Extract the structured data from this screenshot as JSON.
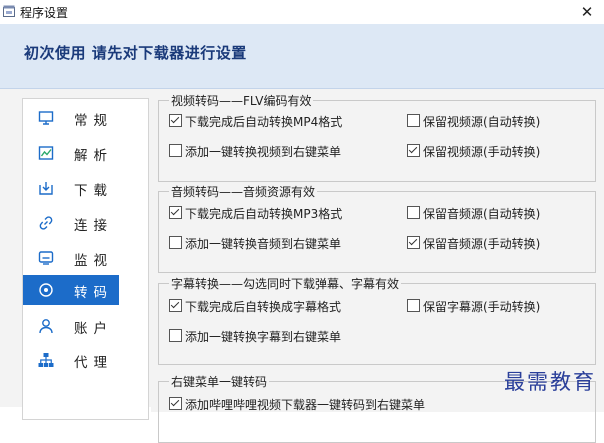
{
  "window": {
    "title": "程序设置"
  },
  "header": {
    "text": "初次使用 请先对下载器进行设置"
  },
  "sidebar": {
    "items": [
      {
        "label": "常规",
        "icon": "monitor-icon",
        "active": false
      },
      {
        "label": "解析",
        "icon": "chart-icon",
        "active": false
      },
      {
        "label": "下载",
        "icon": "download-icon",
        "active": false
      },
      {
        "label": "连接",
        "icon": "link-icon",
        "active": false
      },
      {
        "label": "监视",
        "icon": "screen-icon",
        "active": false
      },
      {
        "label": "转码",
        "icon": "convert-icon",
        "active": true
      },
      {
        "label": "账户",
        "icon": "user-icon",
        "active": false
      },
      {
        "label": "代理",
        "icon": "network-icon",
        "active": false
      }
    ]
  },
  "groups": [
    {
      "legend": "视频转码——FLV编码有效",
      "options": [
        {
          "label": "下载完成后自动转换MP4格式",
          "checked": true
        },
        {
          "label": "保留视频源(自动转换)",
          "checked": false
        },
        {
          "label": "添加一键转换视频到右键菜单",
          "checked": false
        },
        {
          "label": "保留视频源(手动转换)",
          "checked": true
        }
      ]
    },
    {
      "legend": "音频转码——音频资源有效",
      "options": [
        {
          "label": "下载完成后自动转换MP3格式",
          "checked": true
        },
        {
          "label": "保留音频源(自动转换)",
          "checked": false
        },
        {
          "label": "添加一键转换音频到右键菜单",
          "checked": false
        },
        {
          "label": "保留音频源(手动转换)",
          "checked": true
        }
      ]
    },
    {
      "legend": "字幕转换——勾选同时下载弹幕、字幕有效",
      "options": [
        {
          "label": "下载完成后自转换成字幕格式",
          "checked": true
        },
        {
          "label": "保留字幕源(手动转换)",
          "checked": false
        },
        {
          "label": "添加一键转换字幕到右键菜单",
          "checked": false
        }
      ]
    },
    {
      "legend": "右键菜单一键转码",
      "options": [
        {
          "label": "添加哔哩哔哩视频下载器一键转码到右键菜单",
          "checked": true
        }
      ]
    }
  ],
  "watermark": {
    "text": "最需教育"
  },
  "colors": {
    "accent": "#1c6cc9",
    "header_bg": "#dde8f5",
    "header_text": "#1a3a7a",
    "watermark": "#2a3f9a"
  }
}
